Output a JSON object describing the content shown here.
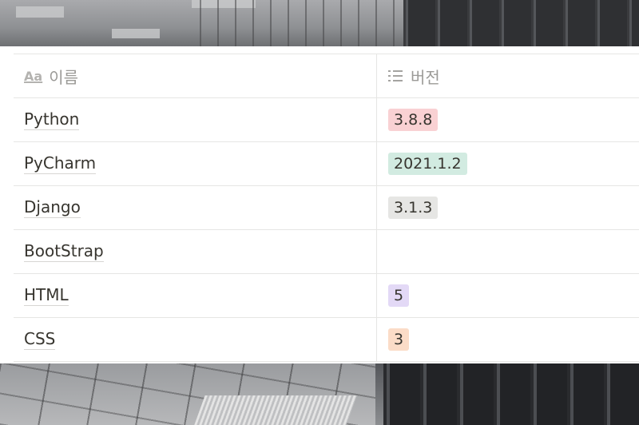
{
  "table": {
    "headers": {
      "name_icon": "Aa",
      "name_label": "이름",
      "version_label": "버전"
    },
    "rows": [
      {
        "name": "Python",
        "version": "3.8.8",
        "tag_color": "#f9d1d3"
      },
      {
        "name": "PyCharm",
        "version": "2021.1.2",
        "tag_color": "#d2ebe1"
      },
      {
        "name": "Django",
        "version": "3.1.3",
        "tag_color": "#e6e6e4"
      },
      {
        "name": "BootStrap",
        "version": "",
        "tag_color": ""
      },
      {
        "name": "HTML",
        "version": "5",
        "tag_color": "#e3d9f6"
      },
      {
        "name": "CSS",
        "version": "3",
        "tag_color": "#fbdcc7"
      }
    ]
  }
}
